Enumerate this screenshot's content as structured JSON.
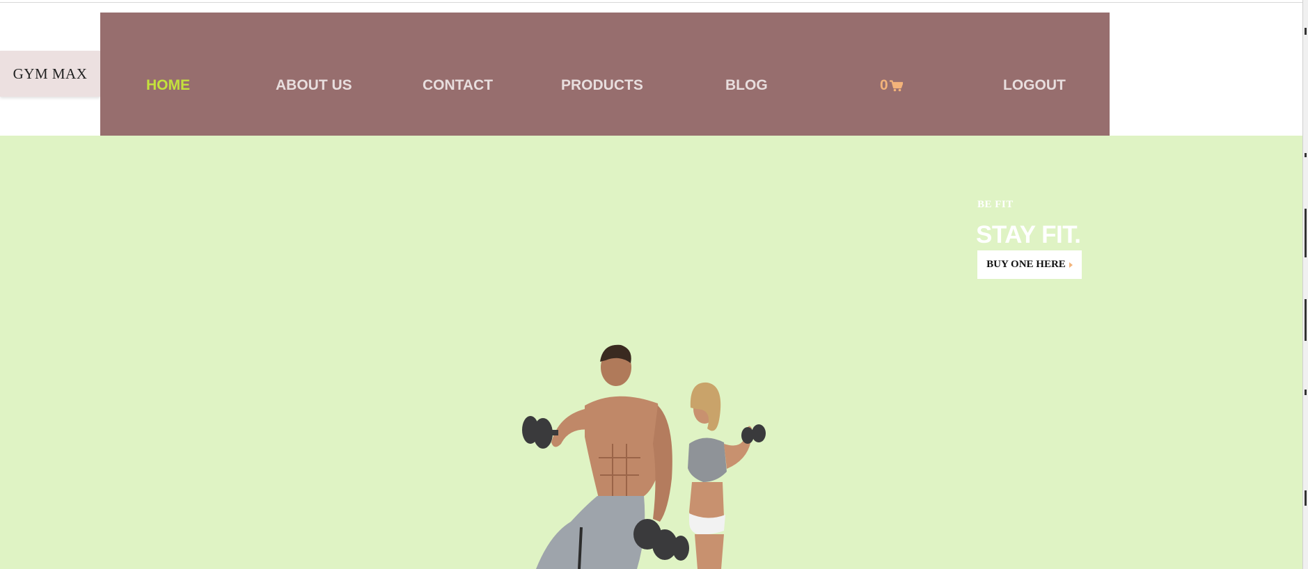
{
  "brand": {
    "logo_text": "GYM MAX"
  },
  "nav": {
    "items": [
      {
        "label": "HOME",
        "active": true
      },
      {
        "label": "ABOUT US"
      },
      {
        "label": "CONTACT"
      },
      {
        "label": "PRODUCTS"
      },
      {
        "label": "BLOG"
      },
      {
        "label": "0",
        "icon": "cart-icon"
      },
      {
        "label": "LOGOUT"
      }
    ]
  },
  "hero": {
    "kicker": "BE FIT",
    "title": "STAY FIT.",
    "cta_label": "BUY ONE HERE",
    "cta_icon": "chevron-right-icon",
    "image": "fitness-couple-dumbbells"
  },
  "colors": {
    "navbar_bg": "#976e6e",
    "nav_text": "#e8dede",
    "nav_active": "#c4e23c",
    "cart_accent": "#f3b37a",
    "logo_bg": "#ece0e0",
    "hero_bg": "#dff3c4"
  }
}
